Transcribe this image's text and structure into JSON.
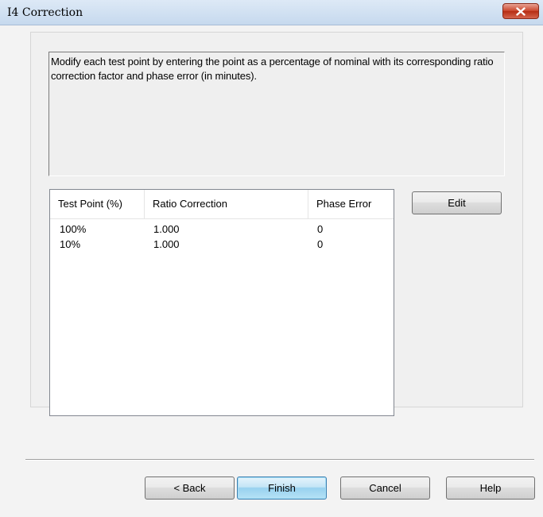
{
  "window": {
    "title": "I4 Correction",
    "close_icon": "close-x-icon"
  },
  "description": "Modify each test point by entering the point as a percentage of nominal with its corresponding ratio correction factor and phase error (in minutes).",
  "table": {
    "columns": [
      "Test Point (%)",
      "Ratio Correction",
      "Phase Error"
    ],
    "rows": [
      [
        "100%",
        "1.000",
        "0"
      ],
      [
        "10%",
        "1.000",
        "0"
      ]
    ]
  },
  "buttons": {
    "edit": "Edit",
    "back": "< Back",
    "finish": "Finish",
    "cancel": "Cancel",
    "help": "Help"
  },
  "colors": {
    "titlebar": "#c6d9ee",
    "close_button": "#c9432a",
    "default_button": "#98d1ef"
  }
}
